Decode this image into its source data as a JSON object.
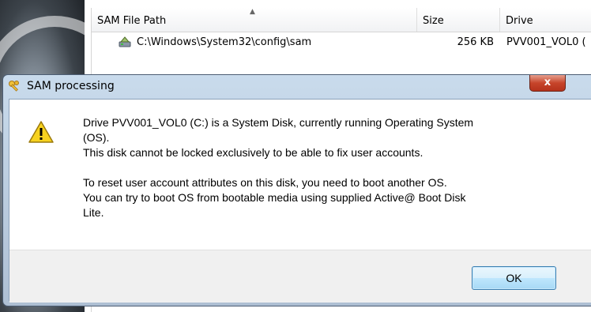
{
  "list": {
    "columns": {
      "path": "SAM File Path",
      "size": "Size",
      "drive": "Drive"
    },
    "rows": [
      {
        "path": "C:\\Windows\\System32\\config\\sam",
        "size": "256 KB",
        "drive": "PVV001_VOL0 ("
      }
    ]
  },
  "dialog": {
    "title": "SAM processing",
    "close_label": "x",
    "message": {
      "p1_line1": "Drive PVV001_VOL0 (C:) is a System Disk, currently running Operating System",
      "p1_line2": "(OS).",
      "p1_line3": "This disk cannot be locked exclusively to be able to fix user accounts.",
      "p2_line1": "To reset user account attributes on this disk, you need to boot another OS.",
      "p2_line2": "You can try to boot OS from bootable media using supplied Active@ Boot Disk",
      "p2_line3": "Lite."
    },
    "ok_label": "OK"
  },
  "icons": {
    "title": "keys-icon",
    "message": "warning-icon",
    "row": "disk-file-icon"
  },
  "colors": {
    "close_button": "#c7452b",
    "ok_border": "#3c7fb1",
    "warning_fill": "#f7d21f"
  }
}
